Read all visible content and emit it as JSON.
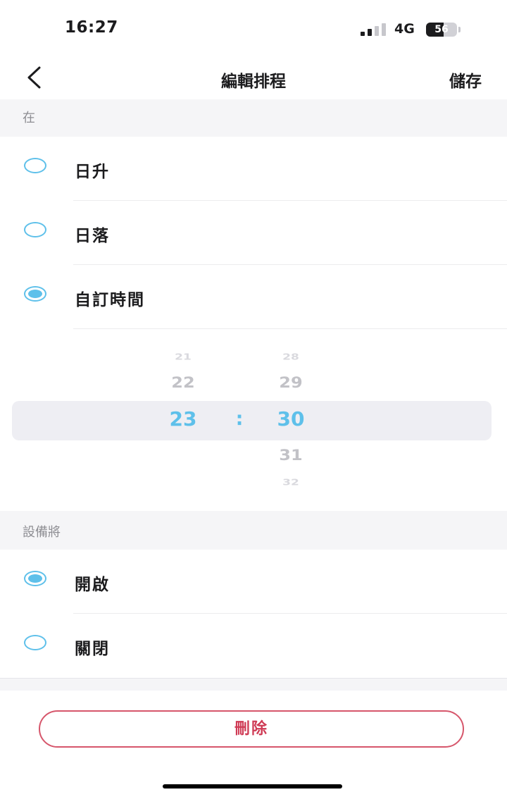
{
  "status_bar": {
    "time": "16:27",
    "network": "4G",
    "battery": "56",
    "battery_level": 0.56,
    "signal_bars_active": 2,
    "signal_bars_total": 4
  },
  "nav": {
    "title": "編輯排程",
    "save_label": "儲存",
    "back_icon": "chevron-left-icon"
  },
  "schedule_at": {
    "header": "在",
    "options": [
      {
        "label": "日升",
        "selected": false
      },
      {
        "label": "日落",
        "selected": false
      },
      {
        "label": "自訂時間",
        "selected": true
      }
    ]
  },
  "time_picker": {
    "hours": [
      "21",
      "22",
      "23"
    ],
    "minutes": [
      "28",
      "29",
      "30",
      "31",
      "32"
    ],
    "separator": ":",
    "selected_hour": "23",
    "selected_minute": "30"
  },
  "device_action": {
    "header": "設備將",
    "options": [
      {
        "label": "開啟",
        "selected": true
      },
      {
        "label": "關閉",
        "selected": false
      }
    ]
  },
  "delete_label": "刪除",
  "colors": {
    "accent": "#5ec0ea",
    "danger": "#cf3b55",
    "section_bg": "#f5f5f7"
  }
}
